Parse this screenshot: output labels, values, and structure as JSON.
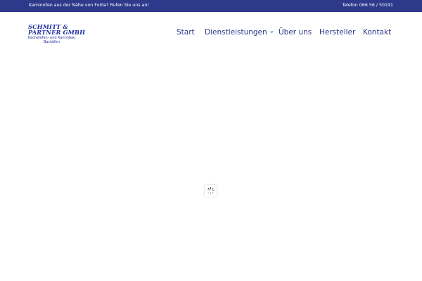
{
  "topbar": {
    "left_text": "Kaminofen aus der Nähe von Fulda? Rufen Sie uns an!",
    "phone_text": "Telefon 066 56 / 50191",
    "bg_color": "#2d3a8c"
  },
  "logo": {
    "line1": "SCHMITT &",
    "line2": "PARTNER GMBH",
    "line3": "Kachelofen- und Kaminbau",
    "line4": "Backöfen",
    "color": "#1e2f9e"
  },
  "nav": {
    "items": [
      {
        "label": "Start"
      },
      {
        "label": "Dienstleistungen",
        "icon": "chevron-down-icon"
      },
      {
        "label": "Über uns"
      },
      {
        "label": "Hersteller"
      },
      {
        "label": "Kontakt"
      }
    ],
    "color": "#2d3a8c"
  },
  "loader": {
    "icon": "spinner-icon"
  }
}
